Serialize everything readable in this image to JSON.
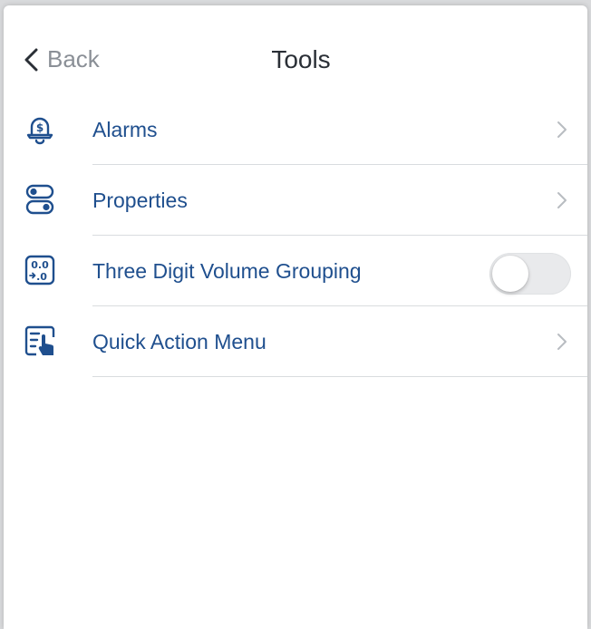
{
  "nav": {
    "back_label": "Back",
    "title": "Tools"
  },
  "items": [
    {
      "label": "Alarms",
      "icon": "dollar-alarm-bell-icon",
      "control": "chevron"
    },
    {
      "label": "Properties",
      "icon": "toggles-properties-icon",
      "control": "chevron"
    },
    {
      "label": "Three Digit Volume Grouping",
      "icon": "decimal-digit-grouping-icon",
      "control": "toggle",
      "toggle_on": false
    },
    {
      "label": "Quick Action Menu",
      "icon": "quick-action-menu-icon",
      "control": "chevron"
    }
  ],
  "colors": {
    "accent": "#1f4f8e",
    "back_text": "#8a8f96",
    "title_text": "#2a2f36",
    "separator": "#d9dcdf",
    "chevron": "#b8bcc1",
    "toggle_off": "#e9eaec"
  }
}
